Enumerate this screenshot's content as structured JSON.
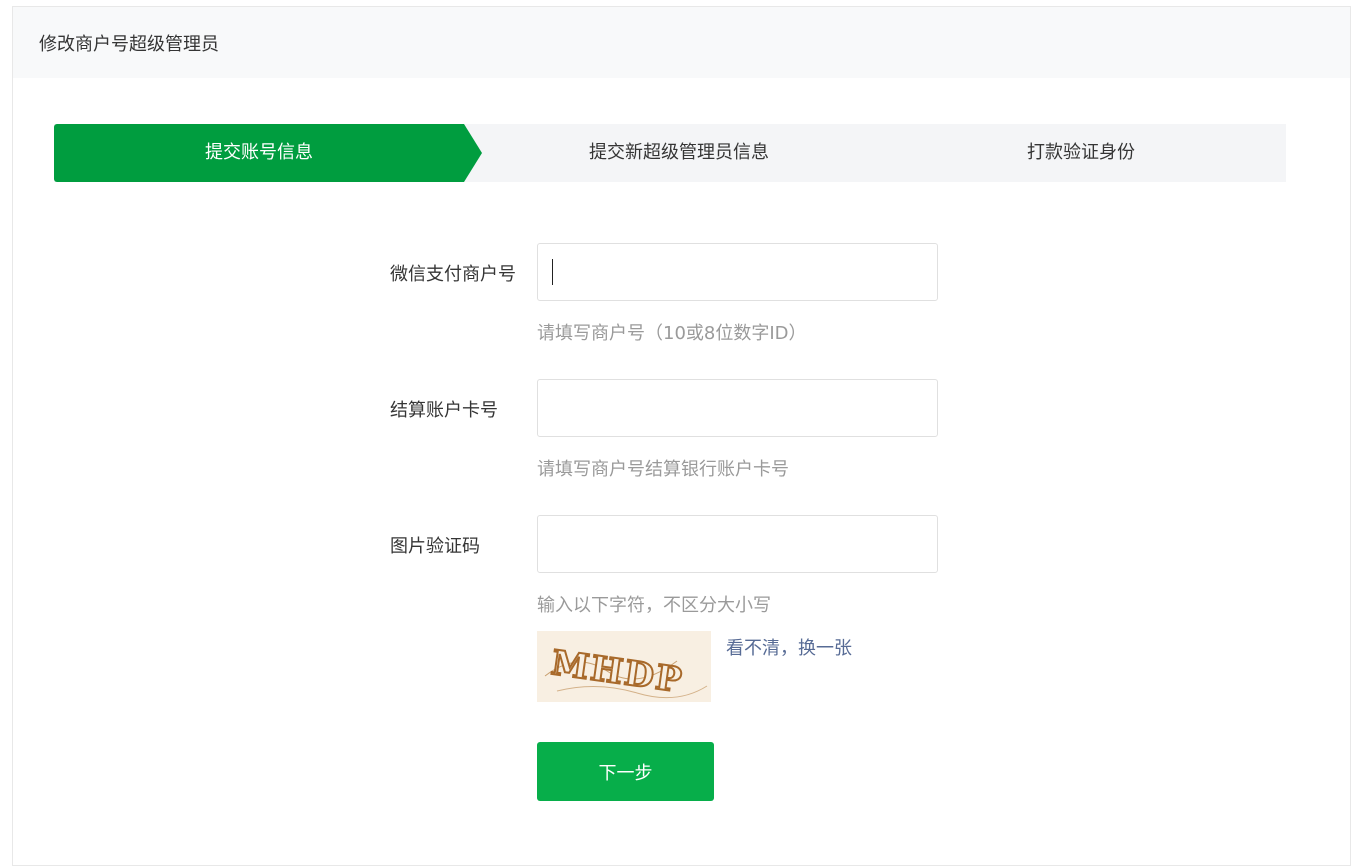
{
  "header": {
    "title": "修改商户号超级管理员"
  },
  "steps": [
    {
      "label": "提交账号信息",
      "active": true
    },
    {
      "label": "提交新超级管理员信息",
      "active": false
    },
    {
      "label": "打款验证身份",
      "active": false
    }
  ],
  "form": {
    "merchant_id": {
      "label": "微信支付商户号",
      "value": "",
      "hint": "请填写商户号（10或8位数字ID）"
    },
    "account_no": {
      "label": "结算账户卡号",
      "value": "",
      "hint": "请填写商户号结算银行账户卡号"
    },
    "captcha": {
      "label": "图片验证码",
      "value": "",
      "hint": "输入以下字符，不区分大小写",
      "image_text": "MHDP",
      "refresh_label": "看不清，换一张"
    },
    "next_label": "下一步"
  },
  "colors": {
    "active_step": "#009d3f",
    "button": "#07ae4a",
    "link": "#576b95",
    "captcha_text": "#a8692a"
  }
}
